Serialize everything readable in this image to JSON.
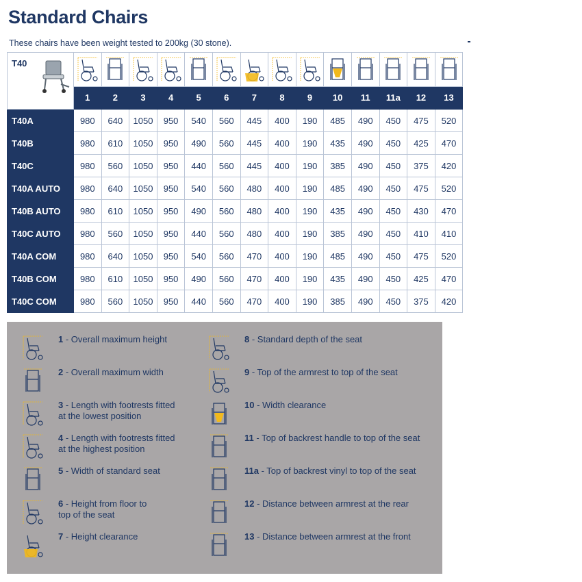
{
  "page": {
    "title": "Standard Chairs",
    "subtitle": "These chairs have been weight tested to 200kg (30 stone)."
  },
  "table": {
    "model_code": "T40",
    "columns": [
      "1",
      "2",
      "3",
      "4",
      "5",
      "6",
      "7",
      "8",
      "9",
      "10",
      "11",
      "11a",
      "12",
      "13"
    ],
    "column_icons": [
      "chair-side-height-icon",
      "chair-front-width-icon",
      "chair-side-length-icon",
      "chair-side-length-high-icon",
      "chair-front-seat-width-icon",
      "chair-side-seat-height-icon",
      "chair-height-clearance-icon",
      "chair-side-seat-depth-icon",
      "chair-side-armrest-icon",
      "chair-width-clearance-icon",
      "chair-front-backrest-handle-icon",
      "chair-front-backrest-vinyl-icon",
      "chair-front-armrest-rear-icon",
      "chair-front-armrest-front-icon"
    ],
    "rows": [
      {
        "label": "T40A",
        "values": [
          "980",
          "640",
          "1050",
          "950",
          "540",
          "560",
          "445",
          "400",
          "190",
          "485",
          "490",
          "450",
          "475",
          "520"
        ]
      },
      {
        "label": "T40B",
        "values": [
          "980",
          "610",
          "1050",
          "950",
          "490",
          "560",
          "445",
          "400",
          "190",
          "435",
          "490",
          "450",
          "425",
          "470"
        ]
      },
      {
        "label": "T40C",
        "values": [
          "980",
          "560",
          "1050",
          "950",
          "440",
          "560",
          "445",
          "400",
          "190",
          "385",
          "490",
          "450",
          "375",
          "420"
        ]
      },
      {
        "label": "T40A AUTO",
        "values": [
          "980",
          "640",
          "1050",
          "950",
          "540",
          "560",
          "480",
          "400",
          "190",
          "485",
          "490",
          "450",
          "475",
          "520"
        ]
      },
      {
        "label": "T40B AUTO",
        "values": [
          "980",
          "610",
          "1050",
          "950",
          "490",
          "560",
          "480",
          "400",
          "190",
          "435",
          "490",
          "450",
          "430",
          "470"
        ]
      },
      {
        "label": "T40C AUTO",
        "values": [
          "980",
          "560",
          "1050",
          "950",
          "440",
          "560",
          "480",
          "400",
          "190",
          "385",
          "490",
          "450",
          "410",
          "410"
        ]
      },
      {
        "label": "T40A COM",
        "values": [
          "980",
          "640",
          "1050",
          "950",
          "540",
          "560",
          "470",
          "400",
          "190",
          "485",
          "490",
          "450",
          "475",
          "520"
        ]
      },
      {
        "label": "T40B COM",
        "values": [
          "980",
          "610",
          "1050",
          "950",
          "490",
          "560",
          "470",
          "400",
          "190",
          "435",
          "490",
          "450",
          "425",
          "470"
        ]
      },
      {
        "label": "T40C COM",
        "values": [
          "980",
          "560",
          "1050",
          "950",
          "440",
          "560",
          "470",
          "400",
          "190",
          "385",
          "490",
          "450",
          "375",
          "420"
        ]
      }
    ]
  },
  "legend": {
    "left": [
      {
        "num": "1",
        "text": " - Overall maximum height",
        "icon": "chair-side-height-icon"
      },
      {
        "num": "2",
        "text": " - Overall maximum width",
        "icon": "chair-front-width-icon"
      },
      {
        "num": "3",
        "text": " - Length with footrests fitted",
        "text2": "at the lowest position",
        "icon": "chair-side-length-icon"
      },
      {
        "num": "4",
        "text": " - Length with footrests fitted",
        "text2": "at the highest position",
        "icon": "chair-side-length-high-icon"
      },
      {
        "num": "5",
        "text": " - Width of standard seat",
        "icon": "chair-front-seat-width-icon"
      },
      {
        "num": "6",
        "text": " - Height from floor to",
        "text2": "top of the seat",
        "icon": "chair-side-seat-height-icon"
      },
      {
        "num": "7",
        "text": " - Height clearance",
        "icon": "chair-height-clearance-icon"
      }
    ],
    "right": [
      {
        "num": "8",
        "text": " - Standard depth of the seat",
        "icon": "chair-side-seat-depth-icon"
      },
      {
        "num": "9",
        "text": " - Top of the armrest to top of the seat",
        "icon": "chair-side-armrest-icon"
      },
      {
        "num": "10",
        "text": " - Width clearance",
        "icon": "chair-width-clearance-icon"
      },
      {
        "num": "11",
        "text": " - Top of backrest handle to top of the seat",
        "icon": "chair-front-backrest-handle-icon"
      },
      {
        "num": "11a",
        "text": " - Top of backrest vinyl to top of the seat",
        "icon": "chair-front-backrest-vinyl-icon"
      },
      {
        "num": "12",
        "text": " - Distance between armrest at the rear",
        "icon": "chair-front-armrest-rear-icon"
      },
      {
        "num": "13",
        "text": " - Distance between armrest at the front",
        "icon": "chair-front-armrest-front-icon"
      }
    ]
  },
  "colors": {
    "navy": "#1f3763",
    "legend_bg": "#a9a6a7",
    "highlight_yellow": "#f2b91c"
  }
}
